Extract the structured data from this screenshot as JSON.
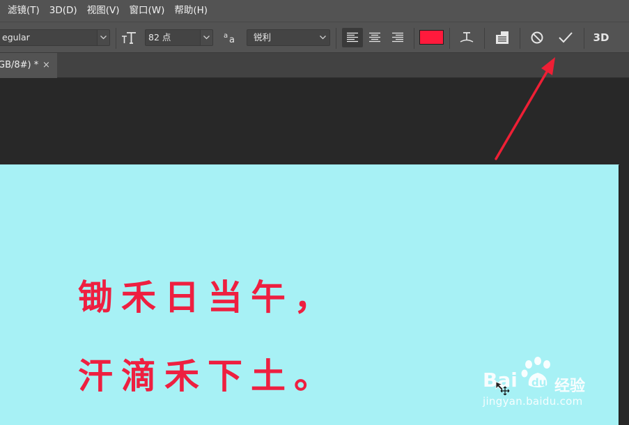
{
  "menu": {
    "items": [
      "滤镜(T)",
      "3D(D)",
      "视图(V)",
      "窗口(W)",
      "帮助(H)"
    ]
  },
  "options": {
    "font_style_value": "egular",
    "font_size_value": "82 点",
    "antialias_value": "锐利",
    "text_color": "#ff1a3c",
    "three_d_label": "3D",
    "icons": [
      "chevron-down-icon",
      "font-size-icon",
      "antialias-icon",
      "align-left-icon",
      "align-center-icon",
      "align-right-icon",
      "warp-text-icon",
      "character-panel-icon",
      "cancel-icon",
      "commit-check-icon",
      "3d-icon"
    ]
  },
  "tabs": {
    "doc_label": "GB/8#) *",
    "close_glyph": "×"
  },
  "canvas": {
    "background": "#a7f1f5",
    "line1": "锄禾日当午，",
    "line2": "汗滴禾下土。"
  },
  "watermark": {
    "brand": "Bai",
    "brand_tail": "经验",
    "url": "jingyan.baidu.com"
  },
  "annotation": {
    "arrow_color": "#ee1f35"
  }
}
